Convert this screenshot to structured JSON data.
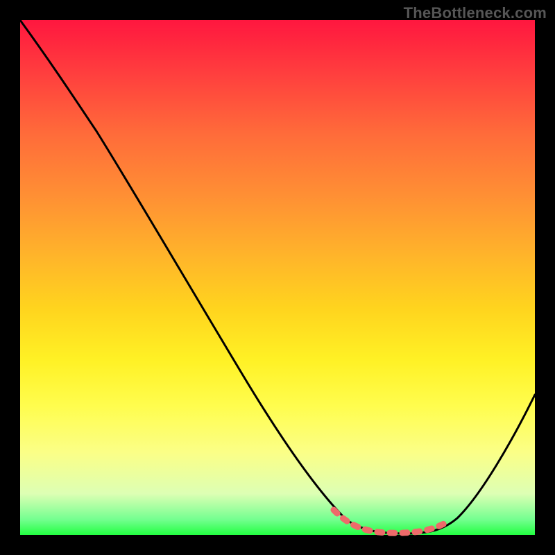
{
  "watermark": "TheBottleneck.com",
  "chart_data": {
    "type": "line",
    "title": "",
    "xlabel": "",
    "ylabel": "",
    "xlim": [
      0,
      100
    ],
    "ylim": [
      0,
      100
    ],
    "series": [
      {
        "name": "black-curve",
        "color": "#000000",
        "x": [
          0,
          8,
          16,
          24,
          32,
          40,
          48,
          56,
          62,
          66,
          70,
          76,
          82,
          88,
          94,
          100
        ],
        "y": [
          100,
          91,
          80,
          67,
          54,
          41,
          28,
          15,
          6,
          2,
          0.5,
          0.5,
          2,
          8,
          17,
          28
        ]
      },
      {
        "name": "pink-dash-overlay",
        "color": "#ee6a6a",
        "x": [
          62,
          66,
          70,
          76,
          82
        ],
        "y": [
          5,
          2,
          1,
          1,
          3
        ]
      }
    ],
    "gradient_stops": [
      {
        "pos": 0,
        "color": "#ff173f"
      },
      {
        "pos": 10,
        "color": "#ff3d3e"
      },
      {
        "pos": 22,
        "color": "#ff6b3a"
      },
      {
        "pos": 34,
        "color": "#ff8f34"
      },
      {
        "pos": 46,
        "color": "#ffb52a"
      },
      {
        "pos": 56,
        "color": "#ffd41e"
      },
      {
        "pos": 66,
        "color": "#fff125"
      },
      {
        "pos": 75,
        "color": "#fffd4e"
      },
      {
        "pos": 84,
        "color": "#fbff87"
      },
      {
        "pos": 92,
        "color": "#ddffb4"
      },
      {
        "pos": 97,
        "color": "#74ff90"
      },
      {
        "pos": 100,
        "color": "#23ff42"
      }
    ]
  }
}
